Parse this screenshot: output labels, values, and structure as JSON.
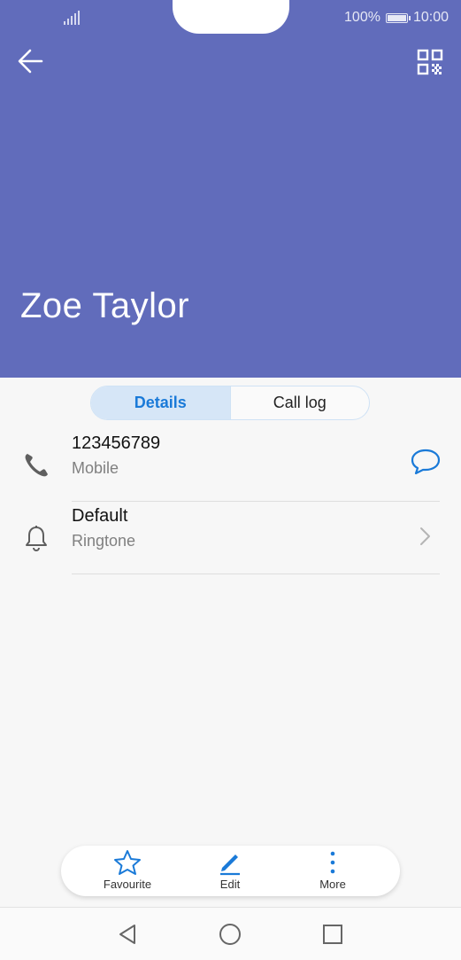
{
  "status_bar": {
    "battery_percent": "100%",
    "time": "10:00"
  },
  "header": {
    "contact_name": "Zoe Taylor",
    "back_icon": "arrow-left-icon",
    "qr_icon": "qr-code-icon",
    "color": "#616cbb"
  },
  "tabs": [
    {
      "label": "Details",
      "active": true
    },
    {
      "label": "Call log",
      "active": false
    }
  ],
  "rows": [
    {
      "primary": "123456789",
      "secondary": "Mobile",
      "icon": "phone-icon",
      "action_icon": "message-icon"
    },
    {
      "primary": "Default",
      "secondary": "Ringtone",
      "icon": "bell-icon",
      "action_icon": "chevron-right-icon"
    }
  ],
  "actions": [
    {
      "label": "Favourite",
      "icon": "star-icon"
    },
    {
      "label": "Edit",
      "icon": "pencil-icon"
    },
    {
      "label": "More",
      "icon": "more-vertical-icon"
    }
  ],
  "nav": {
    "back": "nav-back-icon",
    "home": "nav-home-icon",
    "recents": "nav-recents-icon"
  },
  "colors": {
    "accent": "#1a7ad8"
  }
}
